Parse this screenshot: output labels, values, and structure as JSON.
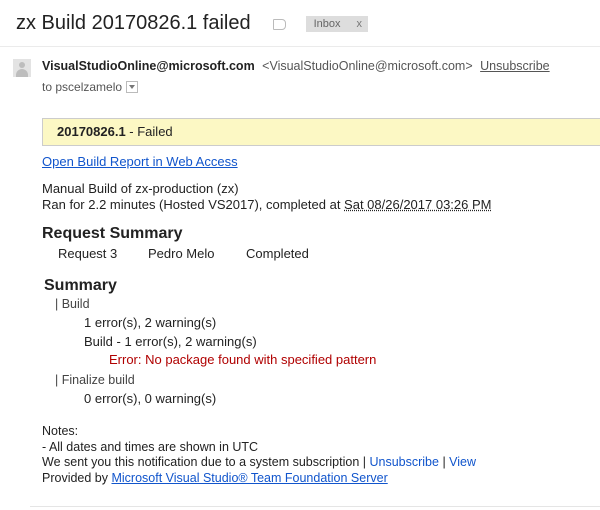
{
  "email": {
    "subject": "zx Build 20170826.1 failed",
    "inbox_label": "Inbox",
    "inbox_close": "x",
    "sender_name": "VisualStudioOnline@microsoft.com",
    "sender_email": "<VisualStudioOnline@microsoft.com>",
    "unsubscribe": "Unsubscribe",
    "to_line": "to pscelzamelo"
  },
  "build": {
    "number": "20170826.1",
    "status": " - Failed",
    "report_link": "Open Build Report in Web Access",
    "desc_line1": "Manual Build of zx-production (zx)",
    "ran_for": "Ran for 2.2 minutes (Hosted VS2017), completed at ",
    "completed_at": "Sat 08/26/2017 03:26 PM"
  },
  "request_summary": {
    "heading": "Request Summary",
    "request": "Request 3",
    "user": "Pedro Melo",
    "status": "Completed"
  },
  "summary": {
    "heading": "Summary",
    "build_section": "| Build",
    "build_counts": "1 error(s), 2 warning(s)",
    "build_step": "Build - 1 error(s), 2 warning(s)",
    "error_message": "Error: No package found with specified pattern",
    "finalize_section": "| Finalize build",
    "finalize_counts": "0 error(s), 0 warning(s)"
  },
  "notes": {
    "title": "Notes:",
    "line1": "- All dates and times are shown in UTC",
    "line2_prefix": "We sent you this notification due to a system subscription | ",
    "unsubscribe": "Unsubscribe",
    "separator": " | ",
    "view": "View",
    "provided_by": "Provided by ",
    "product_link": "Microsoft Visual Studio® Team Foundation Server"
  }
}
